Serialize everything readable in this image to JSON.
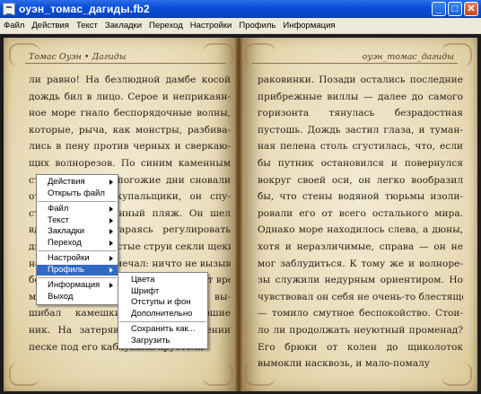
{
  "window": {
    "title": "оуэн_томас_дагиды.fb2",
    "buttons": {
      "minimize": "_",
      "maximize": "□",
      "close": "✕"
    }
  },
  "menubar": {
    "items": [
      "Файл",
      "Действия",
      "Текст",
      "Закладки",
      "Переход",
      "Настройки",
      "Профиль",
      "Информация"
    ]
  },
  "book": {
    "left": {
      "running_head": "Томас Оуэн • Дагиды",
      "lines": [
        "ли равно! На безлюдной дамбе косой",
        "дождь бил в лицо. Серое и неприкаян-",
        "ное море гнало беспорядочные волны,",
        "которые, рыча, как монстры, разбива-",
        "лись в пену против черных и сверкаю-",
        "щих волнорезов. По синим каменным",
        "ступеням, где в погожие дни сновали",
        "отдыхающие и купальщики, он спу-",
        "стился на пустынный пляж. Он шел",
        "вдоль кабин, стараясь регулировать",
        "дыхание. Порывистые струи секли щеки,",
        "но он этого не замечал: ничто не вызывало осо-",
        "бенного интереса. Столько время от вре-",
        "мени, ребром подошвы он вы-",
        "шибал камешки. Но выбежавшие",
        "ник. На затерявшихся в ослеплении",
        "песке под его каблуками хрустели"
      ]
    },
    "right": {
      "running_head": "оуэн_томас_дагиды",
      "lines": [
        "раковинки. Позади остались последние",
        "прибрежные виллы — далее до самого",
        "горизонта тянулась безрадостная",
        "пустошь. Дождь застил глаза, и туман-",
        "ная пелена столь сгустилась, что, если",
        "бы путник остановился и повернулся",
        "вокруг своей оси, он легко вообразил",
        "бы, что стены водяной тюрьмы изоли-",
        "ровали его от всего остального мира.",
        "Однако море находилось слева, а дюны,",
        "хотя и неразличимые, справа — он не",
        "мог заблудиться. К тому же и волноре-",
        "зы служили недурным ориентиром. Но",
        "чувствовал он себя не очень-то блестяще",
        "— томило смутное беспокойство. Стои-",
        "ло ли продолжать неуютный променад?",
        "Его брюки от колен до щиколоток",
        "вымокли насквозь, и мало-помалу"
      ]
    }
  },
  "context_menu": {
    "groups": [
      [
        {
          "label": "Действия",
          "submenu": true
        },
        {
          "label": "Открыть файл",
          "submenu": false
        }
      ],
      [
        {
          "label": "Файл",
          "submenu": true
        },
        {
          "label": "Текст",
          "submenu": true
        },
        {
          "label": "Закладки",
          "submenu": true
        },
        {
          "label": "Переход",
          "submenu": true
        }
      ],
      [
        {
          "label": "Настройки",
          "submenu": true
        },
        {
          "label": "Профиль",
          "submenu": true,
          "highlighted": true
        }
      ],
      [
        {
          "label": "Информация",
          "submenu": true
        },
        {
          "label": "Выход",
          "submenu": false
        }
      ]
    ]
  },
  "submenu_profile": {
    "groups": [
      [
        "Цвета",
        "Шрифт",
        "Отступы и фон",
        "Дополнительно"
      ],
      [
        "Сохранить как...",
        "Загрузить"
      ]
    ]
  }
}
